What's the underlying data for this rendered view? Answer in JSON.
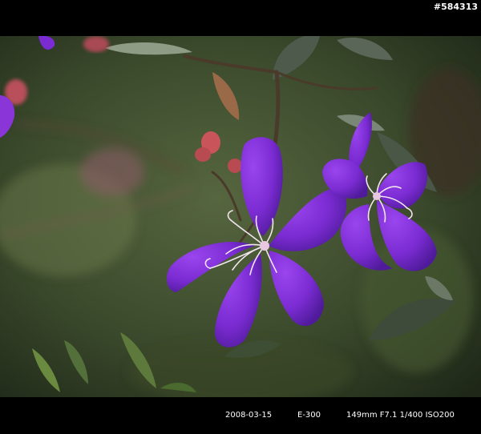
{
  "header": {
    "image_id": "#584313"
  },
  "photo": {
    "subject": "purple flowers with curled stamens on a leafy shrub",
    "colors": {
      "petal": "#7a2bd1",
      "petal_shadow": "#4f1b9a",
      "stamen": "#f2e6f0",
      "bud": "#c9545a",
      "leaf": "#3d4a3a",
      "background": "#2d3a24"
    }
  },
  "exif": {
    "date": "2008-03-15",
    "camera": "E-300",
    "settings": "149mm  F7.1  1/400  ISO200"
  }
}
